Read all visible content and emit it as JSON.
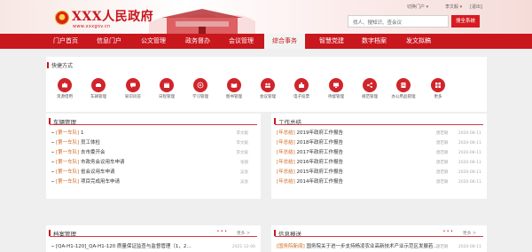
{
  "header": {
    "title": "XXX人民政府",
    "url": "www.xxxgov.cn",
    "top_links": [
      "切换门户 ▾",
      "李文毅 ▾",
      "[退出]"
    ],
    "search_placeholder": "找人、搜知识、查会议",
    "search_button": "搜全系统"
  },
  "nav": {
    "items": [
      "门户首页",
      "信息门户",
      "公文管理",
      "政务督办",
      "会议管理",
      "综合事务",
      "智慧党建",
      "数字档案",
      "发文拟稿"
    ],
    "active_index": 5
  },
  "quick": {
    "title": "快捷方式",
    "items": [
      {
        "label": "资源借用",
        "icon": "briefcase-icon"
      },
      {
        "label": "车辆管理",
        "icon": "car-icon"
      },
      {
        "label": "知识问答",
        "icon": "chat-icon"
      },
      {
        "label": "日程管理",
        "icon": "calendar-icon"
      },
      {
        "label": "学习管理",
        "icon": "play-icon"
      },
      {
        "label": "图书管理",
        "icon": "book-icon"
      },
      {
        "label": "会议管理",
        "icon": "meeting-icon"
      },
      {
        "label": "电子投票",
        "icon": "vote-icon"
      },
      {
        "label": "待督管理",
        "icon": "monitor-icon"
      },
      {
        "label": "规范管理",
        "icon": "share-icon"
      },
      {
        "label": "办公用品管理",
        "icon": "supplies-icon"
      },
      {
        "label": "更多",
        "icon": "more-icon"
      }
    ]
  },
  "vehicle": {
    "title": "车辆管理",
    "rows": [
      {
        "tag": "[第一车队]",
        "text": "1",
        "who": "李文毅"
      },
      {
        "tag": "[第一车队]",
        "text": "员工体检",
        "who": "李文毅"
      },
      {
        "tag": "[第一车队]",
        "text": "去市委开会",
        "who": "李文毅"
      },
      {
        "tag": "[第一车队]",
        "text": "市政务会议用车申请",
        "who": "张丽"
      },
      {
        "tag": "[第一车队]",
        "text": "省会议用车申请",
        "who": "吴会"
      },
      {
        "tag": "[第一车队]",
        "text": "项目完成用车申请",
        "who": "吴会"
      }
    ]
  },
  "summary": {
    "title": "工作总结",
    "rows": [
      {
        "tag": "[年总结]",
        "text": "2019年政府工作报告",
        "who": "唐若颖",
        "date": "2020-08-11"
      },
      {
        "tag": "[年总结]",
        "text": "2018年政府工作报告",
        "who": "唐若颖",
        "date": "2020-08-11"
      },
      {
        "tag": "[年总结]",
        "text": "2017年政府工作报告",
        "who": "唐若颖",
        "date": "2020-08-11"
      },
      {
        "tag": "[年总结]",
        "text": "2016年政府工作报告",
        "who": "唐若颖",
        "date": "2020-08-11"
      },
      {
        "tag": "[年总结]",
        "text": "2015年政府工作报告",
        "who": "唐若颖",
        "date": "2020-08-11"
      },
      {
        "tag": "[年总结]",
        "text": "2014年政府工作报告",
        "who": "唐若颖",
        "date": "2020-08-11"
      }
    ]
  },
  "archive": {
    "title": "档案管理",
    "more": "更多 >",
    "rows": [
      {
        "text": "[QA-H1-120]_QA-H1-120 质量保证监查与监督管理（1，2…",
        "date": "2021-12-06"
      }
    ]
  },
  "news": {
    "title": "信息报送",
    "more": "更多 >",
    "rows": [
      {
        "tag": "[国务院新闻]",
        "text": "国务院关于进一步支持杨凌农业高新技术产业示范区发展若…",
        "who": "唐若颖",
        "date": "2020-08-11"
      }
    ]
  },
  "colors": {
    "primary": "#c9171e",
    "tag": "#d2691e",
    "background": "#efefef"
  }
}
